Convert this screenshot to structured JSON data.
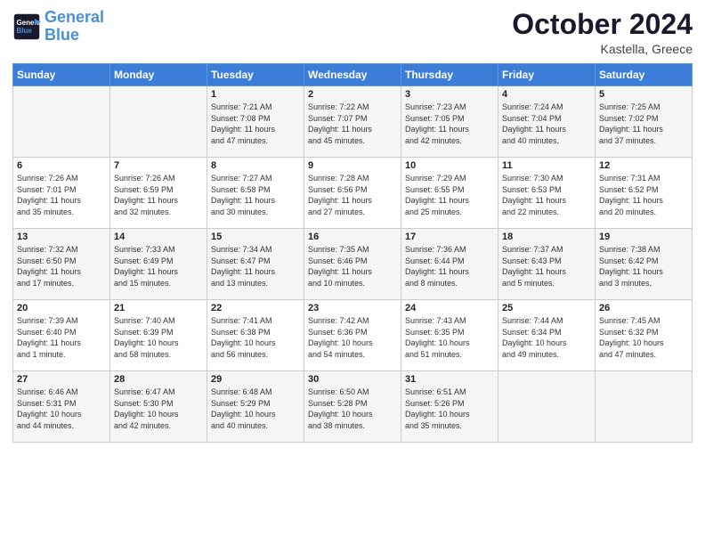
{
  "header": {
    "logo_line1": "General",
    "logo_line2": "Blue",
    "month": "October 2024",
    "location": "Kastella, Greece"
  },
  "days_of_week": [
    "Sunday",
    "Monday",
    "Tuesday",
    "Wednesday",
    "Thursday",
    "Friday",
    "Saturday"
  ],
  "weeks": [
    [
      {
        "day": "",
        "content": ""
      },
      {
        "day": "",
        "content": ""
      },
      {
        "day": "1",
        "content": "Sunrise: 7:21 AM\nSunset: 7:08 PM\nDaylight: 11 hours\nand 47 minutes."
      },
      {
        "day": "2",
        "content": "Sunrise: 7:22 AM\nSunset: 7:07 PM\nDaylight: 11 hours\nand 45 minutes."
      },
      {
        "day": "3",
        "content": "Sunrise: 7:23 AM\nSunset: 7:05 PM\nDaylight: 11 hours\nand 42 minutes."
      },
      {
        "day": "4",
        "content": "Sunrise: 7:24 AM\nSunset: 7:04 PM\nDaylight: 11 hours\nand 40 minutes."
      },
      {
        "day": "5",
        "content": "Sunrise: 7:25 AM\nSunset: 7:02 PM\nDaylight: 11 hours\nand 37 minutes."
      }
    ],
    [
      {
        "day": "6",
        "content": "Sunrise: 7:26 AM\nSunset: 7:01 PM\nDaylight: 11 hours\nand 35 minutes."
      },
      {
        "day": "7",
        "content": "Sunrise: 7:26 AM\nSunset: 6:59 PM\nDaylight: 11 hours\nand 32 minutes."
      },
      {
        "day": "8",
        "content": "Sunrise: 7:27 AM\nSunset: 6:58 PM\nDaylight: 11 hours\nand 30 minutes."
      },
      {
        "day": "9",
        "content": "Sunrise: 7:28 AM\nSunset: 6:56 PM\nDaylight: 11 hours\nand 27 minutes."
      },
      {
        "day": "10",
        "content": "Sunrise: 7:29 AM\nSunset: 6:55 PM\nDaylight: 11 hours\nand 25 minutes."
      },
      {
        "day": "11",
        "content": "Sunrise: 7:30 AM\nSunset: 6:53 PM\nDaylight: 11 hours\nand 22 minutes."
      },
      {
        "day": "12",
        "content": "Sunrise: 7:31 AM\nSunset: 6:52 PM\nDaylight: 11 hours\nand 20 minutes."
      }
    ],
    [
      {
        "day": "13",
        "content": "Sunrise: 7:32 AM\nSunset: 6:50 PM\nDaylight: 11 hours\nand 17 minutes."
      },
      {
        "day": "14",
        "content": "Sunrise: 7:33 AM\nSunset: 6:49 PM\nDaylight: 11 hours\nand 15 minutes."
      },
      {
        "day": "15",
        "content": "Sunrise: 7:34 AM\nSunset: 6:47 PM\nDaylight: 11 hours\nand 13 minutes."
      },
      {
        "day": "16",
        "content": "Sunrise: 7:35 AM\nSunset: 6:46 PM\nDaylight: 11 hours\nand 10 minutes."
      },
      {
        "day": "17",
        "content": "Sunrise: 7:36 AM\nSunset: 6:44 PM\nDaylight: 11 hours\nand 8 minutes."
      },
      {
        "day": "18",
        "content": "Sunrise: 7:37 AM\nSunset: 6:43 PM\nDaylight: 11 hours\nand 5 minutes."
      },
      {
        "day": "19",
        "content": "Sunrise: 7:38 AM\nSunset: 6:42 PM\nDaylight: 11 hours\nand 3 minutes."
      }
    ],
    [
      {
        "day": "20",
        "content": "Sunrise: 7:39 AM\nSunset: 6:40 PM\nDaylight: 11 hours\nand 1 minute."
      },
      {
        "day": "21",
        "content": "Sunrise: 7:40 AM\nSunset: 6:39 PM\nDaylight: 10 hours\nand 58 minutes."
      },
      {
        "day": "22",
        "content": "Sunrise: 7:41 AM\nSunset: 6:38 PM\nDaylight: 10 hours\nand 56 minutes."
      },
      {
        "day": "23",
        "content": "Sunrise: 7:42 AM\nSunset: 6:36 PM\nDaylight: 10 hours\nand 54 minutes."
      },
      {
        "day": "24",
        "content": "Sunrise: 7:43 AM\nSunset: 6:35 PM\nDaylight: 10 hours\nand 51 minutes."
      },
      {
        "day": "25",
        "content": "Sunrise: 7:44 AM\nSunset: 6:34 PM\nDaylight: 10 hours\nand 49 minutes."
      },
      {
        "day": "26",
        "content": "Sunrise: 7:45 AM\nSunset: 6:32 PM\nDaylight: 10 hours\nand 47 minutes."
      }
    ],
    [
      {
        "day": "27",
        "content": "Sunrise: 6:46 AM\nSunset: 5:31 PM\nDaylight: 10 hours\nand 44 minutes."
      },
      {
        "day": "28",
        "content": "Sunrise: 6:47 AM\nSunset: 5:30 PM\nDaylight: 10 hours\nand 42 minutes."
      },
      {
        "day": "29",
        "content": "Sunrise: 6:48 AM\nSunset: 5:29 PM\nDaylight: 10 hours\nand 40 minutes."
      },
      {
        "day": "30",
        "content": "Sunrise: 6:50 AM\nSunset: 5:28 PM\nDaylight: 10 hours\nand 38 minutes."
      },
      {
        "day": "31",
        "content": "Sunrise: 6:51 AM\nSunset: 5:26 PM\nDaylight: 10 hours\nand 35 minutes."
      },
      {
        "day": "",
        "content": ""
      },
      {
        "day": "",
        "content": ""
      }
    ]
  ]
}
